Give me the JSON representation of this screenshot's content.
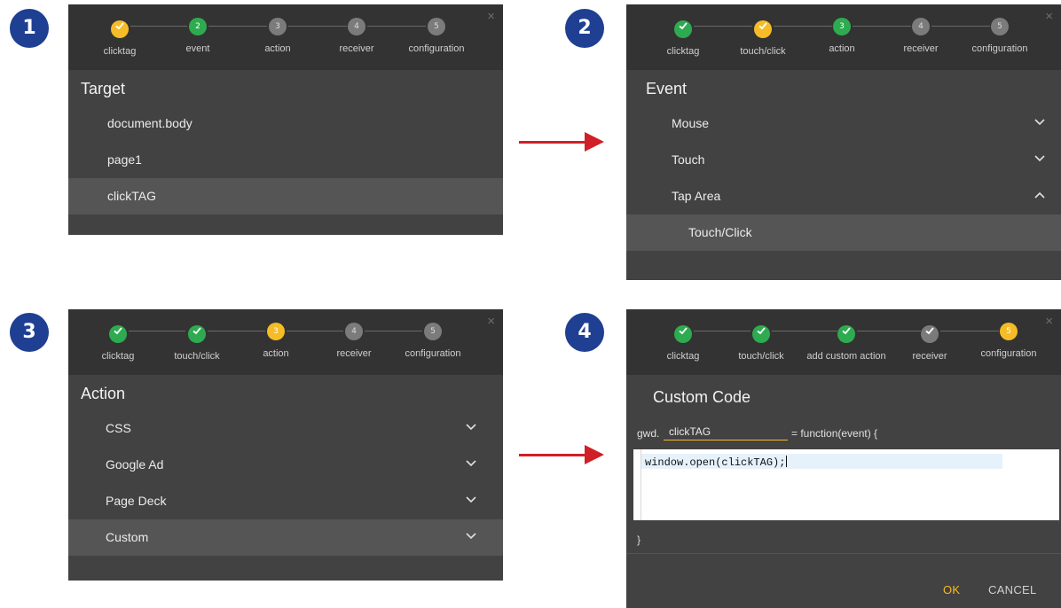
{
  "badges": [
    "1",
    "2",
    "3",
    "4"
  ],
  "close_glyph": "×",
  "panel1": {
    "steps": [
      "clicktag",
      "event",
      "action",
      "receiver",
      "configuration"
    ],
    "step_numbers": [
      "",
      "2",
      "3",
      "4",
      "5"
    ],
    "section_title": "Target",
    "items": [
      "document.body",
      "page1",
      "clickTAG"
    ]
  },
  "panel2": {
    "steps": [
      "clicktag",
      "touch/click",
      "action",
      "receiver",
      "configuration"
    ],
    "step_numbers": [
      "",
      "",
      "3",
      "4",
      "5"
    ],
    "section_title": "Event",
    "items": [
      "Mouse",
      "Touch",
      "Tap Area"
    ],
    "sub_item": "Touch/Click"
  },
  "panel3": {
    "steps": [
      "clicktag",
      "touch/click",
      "action",
      "receiver",
      "configuration"
    ],
    "step_numbers": [
      "",
      "",
      "3",
      "4",
      "5"
    ],
    "section_title": "Action",
    "items": [
      "CSS",
      "Google Ad",
      "Page Deck",
      "Custom"
    ]
  },
  "panel4": {
    "steps": [
      "clicktag",
      "touch/click",
      "add custom action",
      "receiver",
      "configuration"
    ],
    "step_numbers": [
      "",
      "",
      "",
      "",
      "5"
    ],
    "title": "Custom Code",
    "fn_prefix": "gwd.",
    "fn_name": "clickTAG",
    "fn_suffix": "= function(event) {",
    "code": "window.open(clickTAG);",
    "close_brace": "}",
    "ok_label": "OK",
    "cancel_label": "CANCEL"
  },
  "colors": {
    "done": "#2eab50",
    "warning": "#f6bc27",
    "pending": "#7b7b7b",
    "arrow": "#d11f29",
    "badge": "#1f3f92"
  }
}
